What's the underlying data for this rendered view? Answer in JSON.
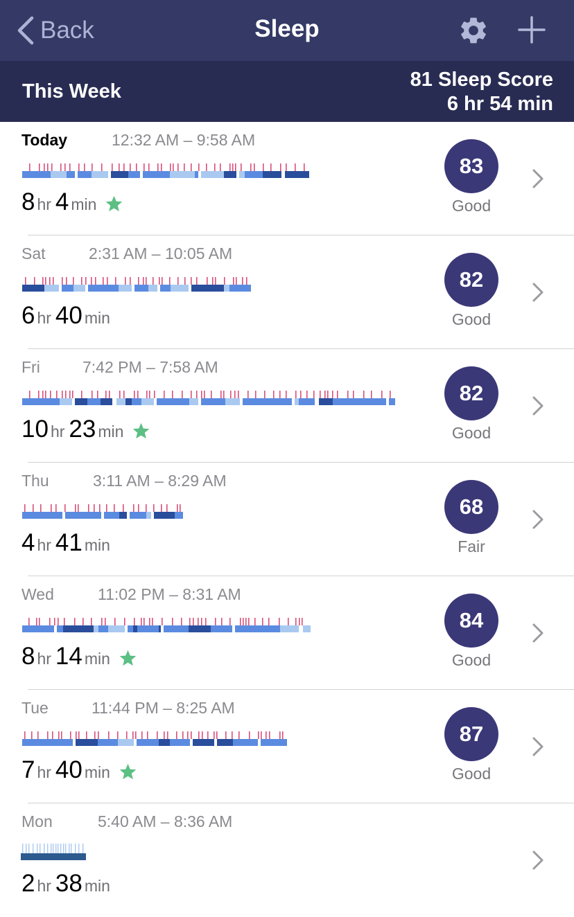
{
  "nav": {
    "back_label": "Back",
    "title": "Sleep",
    "settings_icon": "gear-icon",
    "add_icon": "plus-icon"
  },
  "summary": {
    "period": "This Week",
    "score_line": "81 Sleep Score",
    "duration_line": "6 hr 54 min"
  },
  "colors": {
    "nav_bg": "#343a65",
    "header_bg": "#292c52",
    "score_circle": "#3b3878",
    "awake": "#d84f7a",
    "rem": "#a9c9f0",
    "light": "#5b8be0",
    "deep": "#2a4d9c",
    "restless_bar": "#2d5a8f",
    "star": "#5cbf83"
  },
  "entries": [
    {
      "day": "Today",
      "range": "12:32 AM – 9:58 AM",
      "hours": "8",
      "minutes": "4",
      "hr_unit": "hr",
      "min_unit": "min",
      "star": true,
      "score": "83",
      "rating": "Good",
      "kind": "stages"
    },
    {
      "day": "Sat",
      "range": "2:31 AM – 10:05 AM",
      "hours": "6",
      "minutes": "40",
      "hr_unit": "hr",
      "min_unit": "min",
      "star": false,
      "score": "82",
      "rating": "Good",
      "kind": "stages"
    },
    {
      "day": "Fri",
      "range": "7:42 PM – 7:58 AM",
      "hours": "10",
      "minutes": "23",
      "hr_unit": "hr",
      "min_unit": "min",
      "star": true,
      "score": "82",
      "rating": "Good",
      "kind": "stages"
    },
    {
      "day": "Thu",
      "range": "3:11 AM – 8:29 AM",
      "hours": "4",
      "minutes": "41",
      "hr_unit": "hr",
      "min_unit": "min",
      "star": false,
      "score": "68",
      "rating": "Fair",
      "kind": "stages"
    },
    {
      "day": "Wed",
      "range": "11:02 PM – 8:31 AM",
      "hours": "8",
      "minutes": "14",
      "hr_unit": "hr",
      "min_unit": "min",
      "star": true,
      "score": "84",
      "rating": "Good",
      "kind": "stages"
    },
    {
      "day": "Tue",
      "range": "11:44 PM – 8:25 AM",
      "hours": "7",
      "minutes": "40",
      "hr_unit": "hr",
      "min_unit": "min",
      "star": true,
      "score": "87",
      "rating": "Good",
      "kind": "stages"
    },
    {
      "day": "Mon",
      "range": "5:40 AM – 8:36 AM",
      "hours": "2",
      "minutes": "38",
      "hr_unit": "hr",
      "min_unit": "min",
      "star": false,
      "score": "",
      "rating": "",
      "kind": "classic"
    }
  ]
}
